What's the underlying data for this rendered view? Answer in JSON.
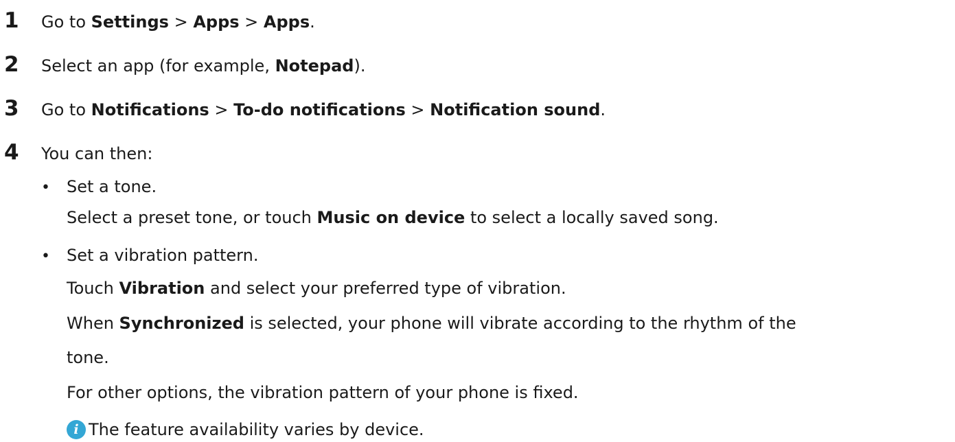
{
  "steps": [
    {
      "number": "1",
      "parts": [
        "Go to ",
        "Settings",
        " > ",
        "Apps",
        " > ",
        "Apps",
        "."
      ]
    },
    {
      "number": "2",
      "parts": [
        "Select an app (for example, ",
        "Notepad",
        ")."
      ]
    },
    {
      "number": "3",
      "parts": [
        "Go to ",
        "Notifications",
        " > ",
        "To-do notifications",
        " > ",
        "Notification sound",
        "."
      ]
    },
    {
      "number": "4",
      "parts": [
        "You can then:"
      ]
    }
  ],
  "options": [
    {
      "bullet": "•",
      "title": "Set a tone.",
      "desc_parts": [
        "Select a preset tone, or touch ",
        "Music on device",
        " to select a locally saved song."
      ]
    },
    {
      "bullet": "•",
      "title": "Set a vibration pattern.",
      "lines": [
        [
          "Touch ",
          "Vibration",
          " and select your preferred type of vibration."
        ],
        [
          "When ",
          "Synchronized",
          " is selected, your phone will vibrate according to the rhythm of the"
        ],
        [
          "tone."
        ],
        [
          "For other options, the vibration pattern of your phone is fixed."
        ]
      ]
    }
  ],
  "note": {
    "icon": "info-icon",
    "text": "The feature availability varies by device.",
    "icon_color": "#34a7d5"
  }
}
